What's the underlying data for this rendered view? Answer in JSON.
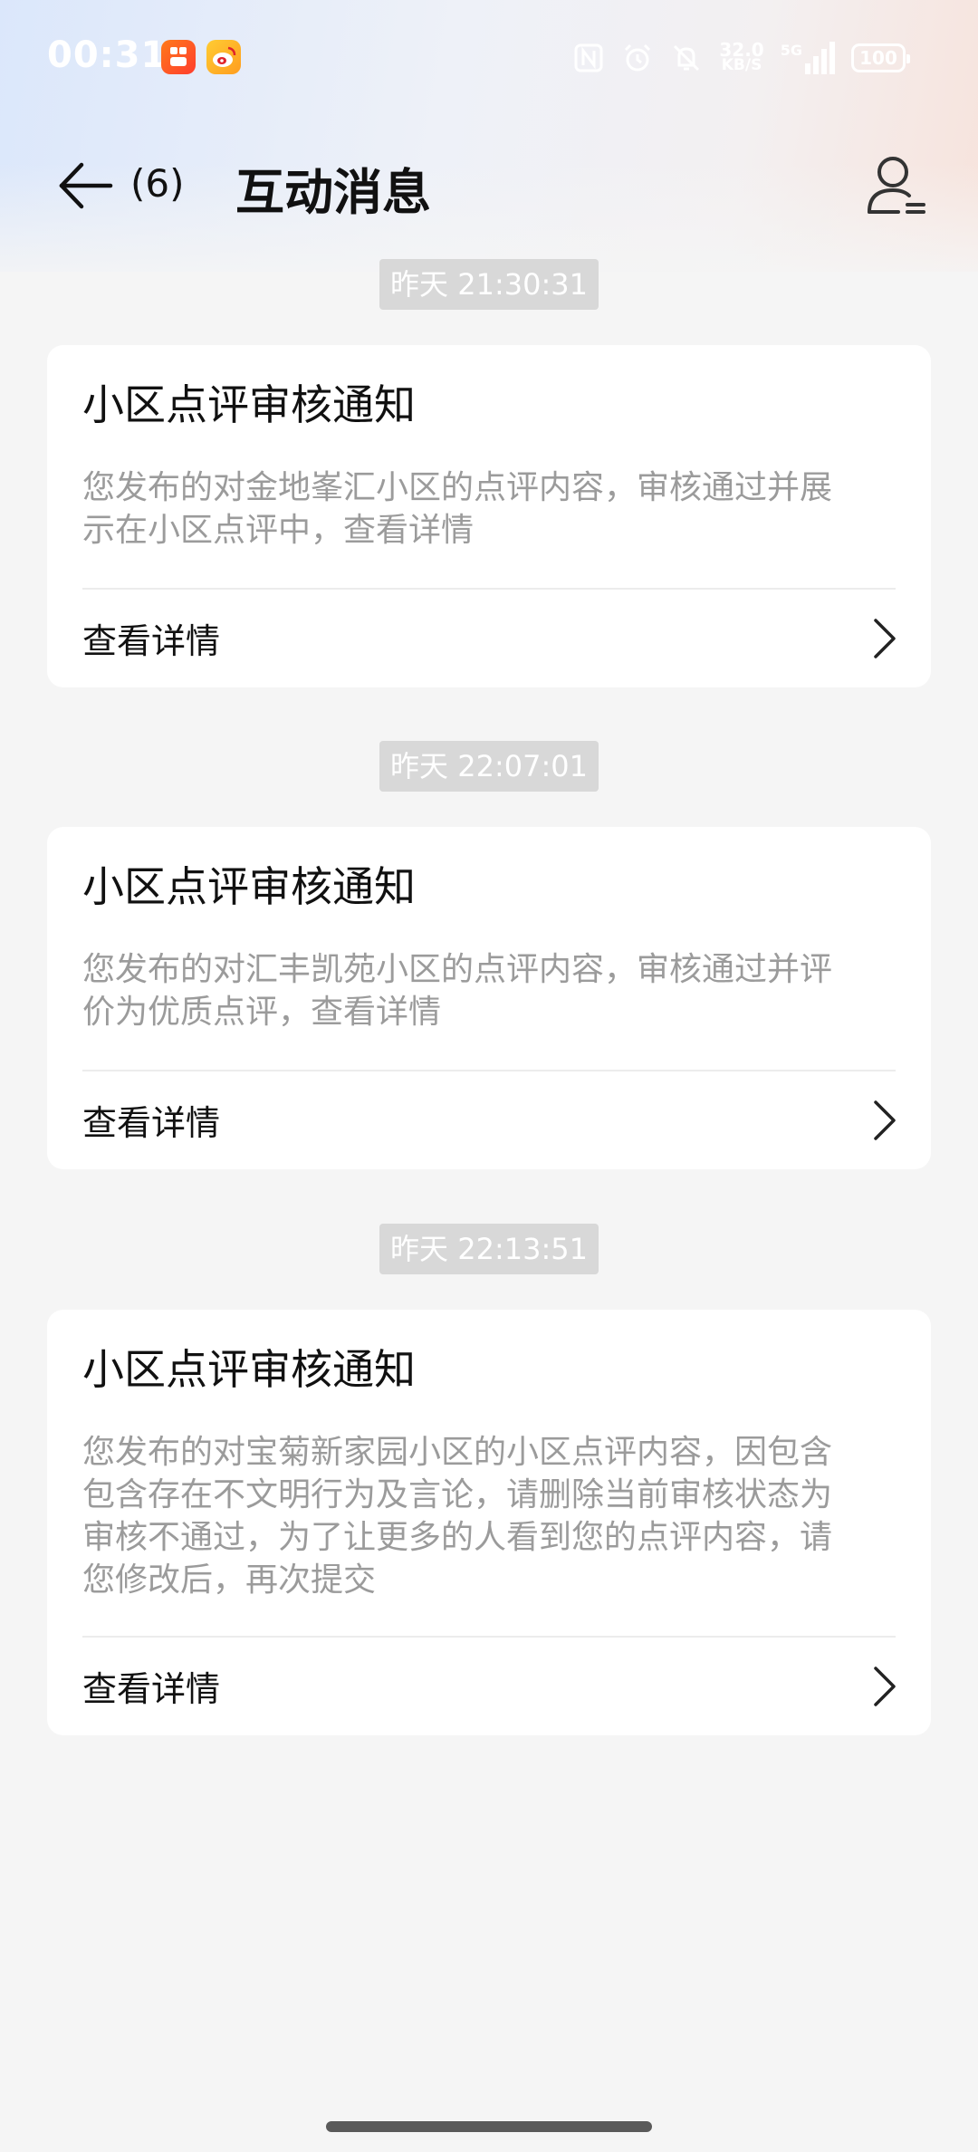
{
  "status_bar": {
    "time": "00:31",
    "net_speed_value": "32.0",
    "net_speed_unit": "KB/S",
    "network": "5G",
    "battery": "100",
    "icons": [
      "app-icon-orange",
      "weibo-icon",
      "nfc-icon",
      "alarm-icon",
      "mute-icon",
      "signal-icon",
      "battery-icon"
    ]
  },
  "header": {
    "unread_count": "(6)",
    "title": "互动消息",
    "icons": [
      "back-arrow-icon",
      "user-menu-icon"
    ]
  },
  "messages": [
    {
      "timestamp": "昨天 21:30:31",
      "title": "小区点评审核通知",
      "body_lines": [
        "您发布的对金地峯汇小区的点评内容，审核通过并展",
        "示在小区点评中，查看详情"
      ],
      "link_label": "查看详情"
    },
    {
      "timestamp": "昨天 22:07:01",
      "title": "小区点评审核通知",
      "body_lines": [
        "您发布的对汇丰凯苑小区的点评内容，审核通过并评",
        "价为优质点评，查看详情"
      ],
      "link_label": "查看详情"
    },
    {
      "timestamp": "昨天 22:13:51",
      "title": "小区点评审核通知",
      "body_lines": [
        "您发布的对宝菊新家园小区的小区点评内容，因包含",
        "包含存在不文明行为及言论，请删除当前审核状态为",
        "审核不通过，为了让更多的人看到您的点评内容，请",
        "您修改后，再次提交"
      ],
      "link_label": "查看详情"
    }
  ],
  "colors": {
    "background": "#f5f5f5",
    "card": "#ffffff",
    "body_text": "#9b9b9b",
    "timestamp_bg": "#d8d8d8"
  }
}
